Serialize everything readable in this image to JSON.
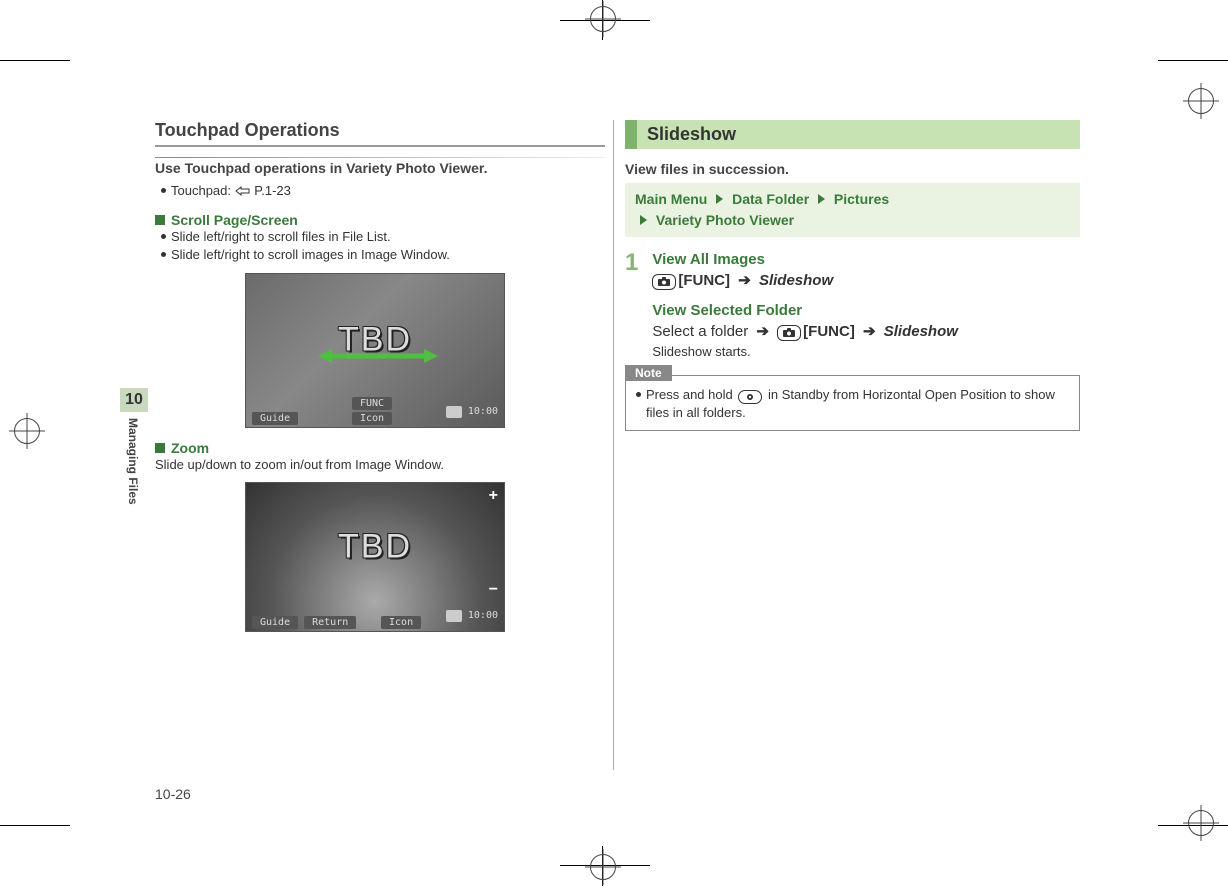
{
  "sidetab": {
    "chapter_num": "10",
    "chapter_label": "Managing Files"
  },
  "page_number": "10-26",
  "left": {
    "section_title": "Touchpad Operations",
    "lead": "Use Touchpad operations in Variety Photo Viewer.",
    "touchpad_ref_label": "Touchpad:",
    "touchpad_ref_page": "P.1-23",
    "scroll": {
      "heading": "Scroll Page/Screen",
      "b1": "Slide left/right to scroll files in File List.",
      "b2": "Slide left/right to scroll images in Image Window."
    },
    "shot1": {
      "tbd": "TBD",
      "soft_guide": "Guide",
      "soft_func": "FUNC",
      "soft_icon": "Icon",
      "clock": "10:00"
    },
    "zoom": {
      "heading": "Zoom",
      "body": "Slide up/down to zoom in/out from Image Window."
    },
    "shot2": {
      "tbd": "TBD",
      "soft_guide": "Guide",
      "soft_return": "Return",
      "soft_icon": "Icon",
      "clock": "10:00"
    }
  },
  "right": {
    "banner": "Slideshow",
    "lead": "View files in succession.",
    "nav": {
      "l1a": "Main Menu",
      "l1b": "Data Folder",
      "l1c": "Pictures",
      "l2a": "Variety Photo Viewer"
    },
    "step1": {
      "num": "1",
      "title_all": "View All Images",
      "func_label": "[FUNC]",
      "slideshow_label": "Slideshow",
      "title_sel": "View Selected Folder",
      "select_folder": "Select a folder",
      "starts": "Slideshow starts."
    },
    "note": {
      "tag": "Note",
      "text_a": "Press and hold",
      "text_b": "in Standby from Horizontal Open Position to show files in all folders."
    }
  }
}
